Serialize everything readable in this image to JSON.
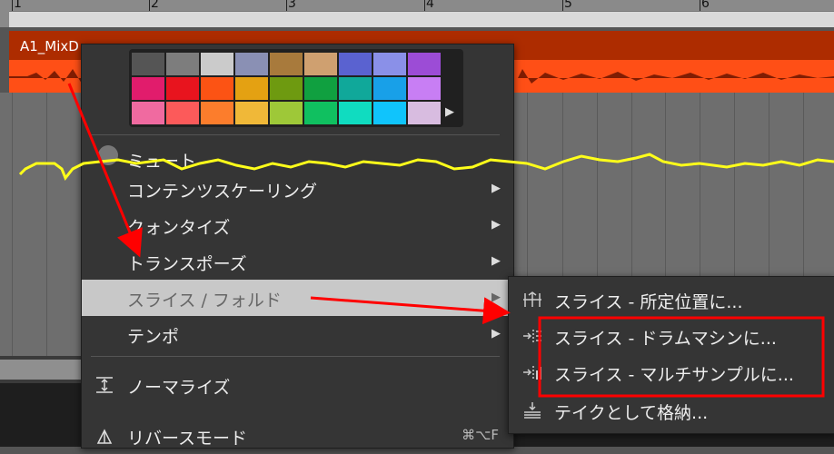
{
  "ruler": {
    "bars": [
      "1",
      "2",
      "3",
      "4",
      "5",
      "6"
    ]
  },
  "clip": {
    "name": "A1_MixD"
  },
  "palette": {
    "colors": [
      [
        "#555555",
        "#7d7d7d",
        "#cbcbcb",
        "#8a90b4",
        "#a87a3c",
        "#cfa070",
        "#5a62d0",
        "#8a90e8",
        "#9c4cd6"
      ],
      [
        "#e11c6c",
        "#e8141e",
        "#fc5314",
        "#e4a112",
        "#6e9a10",
        "#10a040",
        "#10a89a",
        "#18a0e8",
        "#c87ef4"
      ],
      [
        "#f06aa0",
        "#fc5a5a",
        "#fc7d2c",
        "#f0b838",
        "#9ec838",
        "#10c060",
        "#10dcc0",
        "#10c4fc",
        "#d8bce0"
      ]
    ]
  },
  "menu": {
    "mute_label": "ミュート",
    "items": [
      {
        "label": "コンテンツスケーリング",
        "arrow": "▶"
      },
      {
        "label": "クォンタイズ",
        "arrow": "▶"
      },
      {
        "label": "トランスポーズ",
        "arrow": "▶"
      },
      {
        "label": "スライス / フォルド",
        "arrow": "▶"
      },
      {
        "label": "テンポ",
        "arrow": "▶"
      },
      {
        "label": "ノーマライズ",
        "arrow": ""
      },
      {
        "label": "リバースモード",
        "arrow": ""
      }
    ],
    "reverse_shortcut": "⌘⌥F"
  },
  "submenu": {
    "items": [
      {
        "label": "スライス - 所定位置に..."
      },
      {
        "label": "スライス - ドラムマシンに..."
      },
      {
        "label": "スライス - マルチサンプルに..."
      },
      {
        "label": "テイクとして格納..."
      }
    ]
  },
  "annotations": {
    "arrow_color": "#ff0000",
    "highlight_color": "#ff0000",
    "automation_color": "#ffff1a"
  }
}
